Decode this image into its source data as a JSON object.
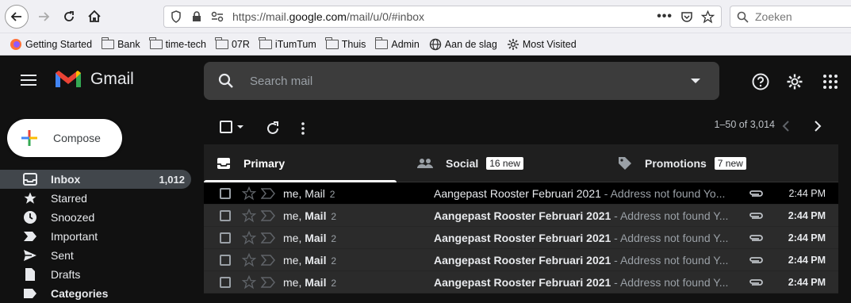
{
  "browser": {
    "url_prefix": "https://mail.",
    "url_domain": "google.com",
    "url_suffix": "/mail/u/0/#inbox",
    "search_placeholder": "Zoeken"
  },
  "bookmarks": [
    {
      "label": "Getting Started",
      "icon": "firefox-icon"
    },
    {
      "label": "Bank",
      "icon": "folder-icon"
    },
    {
      "label": "time-tech",
      "icon": "folder-icon"
    },
    {
      "label": "07R",
      "icon": "folder-icon"
    },
    {
      "label": "iTumTum",
      "icon": "folder-icon"
    },
    {
      "label": "Thuis",
      "icon": "folder-icon"
    },
    {
      "label": "Admin",
      "icon": "folder-icon"
    },
    {
      "label": "Aan de slag",
      "icon": "globe-icon"
    },
    {
      "label": "Most Visited",
      "icon": "gear-icon"
    }
  ],
  "gmail": {
    "logo_text": "Gmail",
    "search_placeholder": "Search mail",
    "compose_label": "Compose",
    "pager": "1–50 of 3,014",
    "nav": [
      {
        "label": "Inbox",
        "count": "1,012",
        "icon": "inbox-icon"
      },
      {
        "label": "Starred",
        "count": "",
        "icon": "star-icon"
      },
      {
        "label": "Snoozed",
        "count": "",
        "icon": "clock-icon"
      },
      {
        "label": "Important",
        "count": "",
        "icon": "important-icon"
      },
      {
        "label": "Sent",
        "count": "",
        "icon": "send-icon"
      },
      {
        "label": "Drafts",
        "count": "",
        "icon": "draft-icon"
      },
      {
        "label": "Categories",
        "count": "",
        "icon": "label-icon"
      }
    ],
    "tabs": [
      {
        "label": "Primary",
        "badge": ""
      },
      {
        "label": "Social",
        "badge": "16 new"
      },
      {
        "label": "Promotions",
        "badge": "7 new"
      }
    ],
    "emails": [
      {
        "sender_prefix": "me, ",
        "sender_name": "Mail",
        "count": "2",
        "subject": "Aangepast Rooster Februari 2021",
        "snippet": " - Address not found Yo...",
        "time": "2:44 PM"
      },
      {
        "sender_prefix": "me, ",
        "sender_name": "Mail",
        "count": "2",
        "subject": "Aangepast Rooster Februari 2021",
        "snippet": " - Address not found Y...",
        "time": "2:44 PM"
      },
      {
        "sender_prefix": "me, ",
        "sender_name": "Mail",
        "count": "2",
        "subject": "Aangepast Rooster Februari 2021",
        "snippet": " - Address not found Y...",
        "time": "2:44 PM"
      },
      {
        "sender_prefix": "me, ",
        "sender_name": "Mail",
        "count": "2",
        "subject": "Aangepast Rooster Februari 2021",
        "snippet": " - Address not found Y...",
        "time": "2:44 PM"
      },
      {
        "sender_prefix": "me, ",
        "sender_name": "Mail",
        "count": "2",
        "subject": "Aangepast Rooster Februari 2021",
        "snippet": " - Address not found Y...",
        "time": "2:44 PM"
      }
    ]
  }
}
